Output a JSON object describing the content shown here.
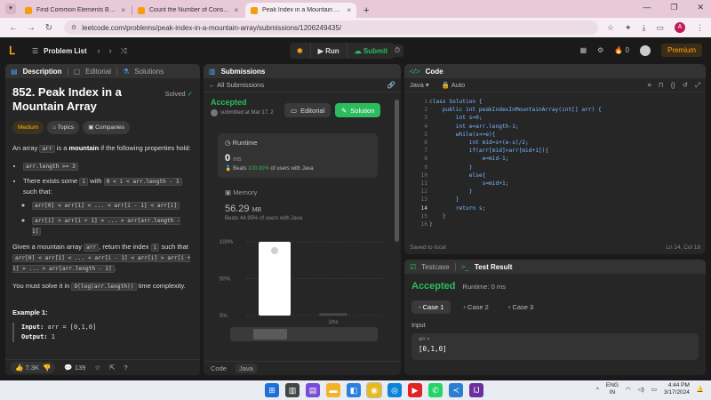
{
  "browser": {
    "tabs": [
      {
        "title": "Find Common Elements Betwe",
        "active": false
      },
      {
        "title": "Count the Number of Consiste",
        "active": false
      },
      {
        "title": "Peak Index in a Mountain Arra",
        "active": true
      }
    ],
    "url": "leetcode.com/problems/peak-index-in-a-mountain-array/submissions/1206249435/"
  },
  "nav": {
    "problem_list": "Problem List",
    "run": "Run",
    "submit": "Submit",
    "streak": "0",
    "premium": "Premium"
  },
  "description": {
    "tabs": [
      "Description",
      "Editorial",
      "Solutions"
    ],
    "title": "852. Peak Index in a Mountain Array",
    "solved": "Solved",
    "chips": [
      "Medium",
      "Topics",
      "Companies"
    ],
    "intro_a": "An array ",
    "intro_code": "arr",
    "intro_b": " is a ",
    "intro_bold": "mountain",
    "intro_c": " if the following properties hold:",
    "b1": "arr.length >= 3",
    "b2_a": "There exists some ",
    "b2_code1": "i",
    "b2_b": " with ",
    "b2_code2": "0 < i < arr.length - 1",
    "b2_c": " such that:",
    "b2_sub1": "arr[0] < arr[1] < ... < arr[i - 1] < arr[i]",
    "b2_sub2": "arr[i] > arr[i + 1] > ... > arr[arr.length - 1]",
    "given_a": "Given a mountain array ",
    "given_code1": "arr",
    "given_b": ", return the index ",
    "given_code2": "i",
    "given_c": " such that ",
    "given_code3": "arr[0] < arr[1] < ... < arr[i - 1] < arr[i] > arr[i + 1] > ... > arr[arr.length - 1]",
    "given_d": ".",
    "solve_a": "You must solve it in ",
    "solve_code": "O(log(arr.length))",
    "solve_b": " time complexity.",
    "example_title": "Example 1:",
    "ex_input_label": "Input:",
    "ex_input": "arr = [0,1,0]",
    "ex_output_label": "Output:",
    "ex_output": "1",
    "likes": "7.3K",
    "comments": "139"
  },
  "submissions": {
    "title": "Submissions",
    "back": "All Submissions",
    "status": "Accepted",
    "submitted": "submitted at Mar 17, 2",
    "editorial": "Editorial",
    "solution": "Solution",
    "runtime_label": "Runtime",
    "runtime_value": "0",
    "runtime_unit": "ms",
    "runtime_beats_a": "Beats ",
    "runtime_beats_pct": "100.00%",
    "runtime_beats_b": " of users with Java",
    "memory_label": "Memory",
    "memory_value": "56.29",
    "memory_unit": "MB",
    "memory_beats": "Beats 44.95% of users with Java",
    "code_tab": "Code",
    "lang_tab": "Java"
  },
  "chart_data": {
    "type": "bar",
    "y_ticks": [
      "100%",
      "50%",
      "0%"
    ],
    "categories": [
      "",
      "1ms"
    ],
    "values": [
      100,
      3
    ],
    "ylim": [
      0,
      100
    ]
  },
  "code": {
    "title": "Code",
    "lang": "Java",
    "mode": "Auto",
    "saved": "Saved to local",
    "cursor": "Ln 14, Col 18",
    "lines": [
      "class Solution {",
      "    public int peakIndexInMountainArray(int[] arr) {",
      "        int s=0;",
      "        int e=arr.length-1;",
      "        while(s<=e){",
      "            int mid=s+(e-s)/2;",
      "            if(arr[mid]>arr[mid+1]){",
      "                e=mid-1;",
      "            }",
      "            else{",
      "                s=mid+1;",
      "            }",
      "        }",
      "        return s;",
      "    }",
      "}"
    ]
  },
  "test": {
    "tab_testcase": "Testcase",
    "tab_result": "Test Result",
    "status": "Accepted",
    "runtime": "Runtime: 0 ms",
    "cases": [
      "Case 1",
      "Case 2",
      "Case 3"
    ],
    "input_label": "Input",
    "input_key": "arr =",
    "input_value": "[0,1,0]"
  },
  "taskbar": {
    "lang_top": "ENG",
    "lang_bottom": "IN",
    "time": "4:44 PM",
    "date": "3/17/2024"
  }
}
